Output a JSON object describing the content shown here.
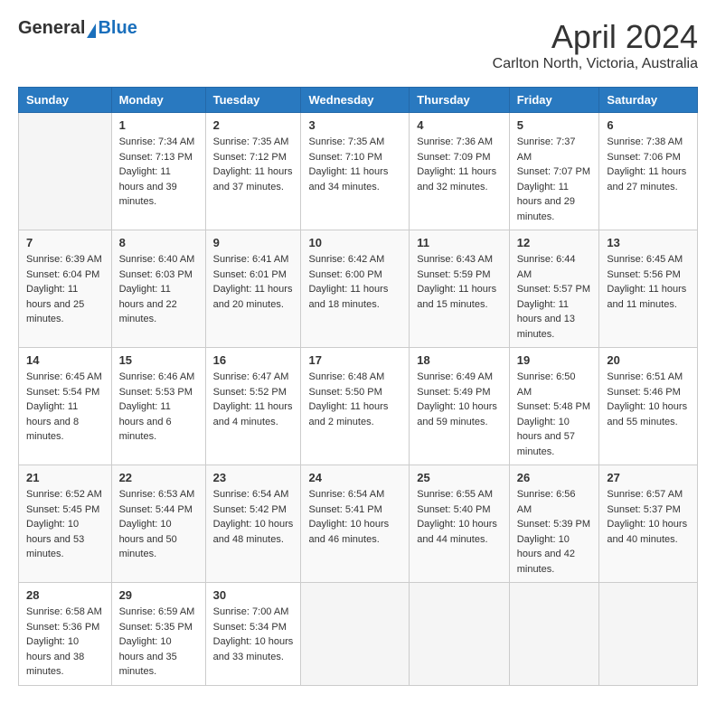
{
  "header": {
    "logo_general": "General",
    "logo_blue": "Blue",
    "month_title": "April 2024",
    "location": "Carlton North, Victoria, Australia"
  },
  "weekdays": [
    "Sunday",
    "Monday",
    "Tuesday",
    "Wednesday",
    "Thursday",
    "Friday",
    "Saturday"
  ],
  "weeks": [
    [
      {
        "day": "",
        "sunrise": "",
        "sunset": "",
        "daylight": ""
      },
      {
        "day": "1",
        "sunrise": "Sunrise: 7:34 AM",
        "sunset": "Sunset: 7:13 PM",
        "daylight": "Daylight: 11 hours and 39 minutes."
      },
      {
        "day": "2",
        "sunrise": "Sunrise: 7:35 AM",
        "sunset": "Sunset: 7:12 PM",
        "daylight": "Daylight: 11 hours and 37 minutes."
      },
      {
        "day": "3",
        "sunrise": "Sunrise: 7:35 AM",
        "sunset": "Sunset: 7:10 PM",
        "daylight": "Daylight: 11 hours and 34 minutes."
      },
      {
        "day": "4",
        "sunrise": "Sunrise: 7:36 AM",
        "sunset": "Sunset: 7:09 PM",
        "daylight": "Daylight: 11 hours and 32 minutes."
      },
      {
        "day": "5",
        "sunrise": "Sunrise: 7:37 AM",
        "sunset": "Sunset: 7:07 PM",
        "daylight": "Daylight: 11 hours and 29 minutes."
      },
      {
        "day": "6",
        "sunrise": "Sunrise: 7:38 AM",
        "sunset": "Sunset: 7:06 PM",
        "daylight": "Daylight: 11 hours and 27 minutes."
      }
    ],
    [
      {
        "day": "7",
        "sunrise": "Sunrise: 6:39 AM",
        "sunset": "Sunset: 6:04 PM",
        "daylight": "Daylight: 11 hours and 25 minutes."
      },
      {
        "day": "8",
        "sunrise": "Sunrise: 6:40 AM",
        "sunset": "Sunset: 6:03 PM",
        "daylight": "Daylight: 11 hours and 22 minutes."
      },
      {
        "day": "9",
        "sunrise": "Sunrise: 6:41 AM",
        "sunset": "Sunset: 6:01 PM",
        "daylight": "Daylight: 11 hours and 20 minutes."
      },
      {
        "day": "10",
        "sunrise": "Sunrise: 6:42 AM",
        "sunset": "Sunset: 6:00 PM",
        "daylight": "Daylight: 11 hours and 18 minutes."
      },
      {
        "day": "11",
        "sunrise": "Sunrise: 6:43 AM",
        "sunset": "Sunset: 5:59 PM",
        "daylight": "Daylight: 11 hours and 15 minutes."
      },
      {
        "day": "12",
        "sunrise": "Sunrise: 6:44 AM",
        "sunset": "Sunset: 5:57 PM",
        "daylight": "Daylight: 11 hours and 13 minutes."
      },
      {
        "day": "13",
        "sunrise": "Sunrise: 6:45 AM",
        "sunset": "Sunset: 5:56 PM",
        "daylight": "Daylight: 11 hours and 11 minutes."
      }
    ],
    [
      {
        "day": "14",
        "sunrise": "Sunrise: 6:45 AM",
        "sunset": "Sunset: 5:54 PM",
        "daylight": "Daylight: 11 hours and 8 minutes."
      },
      {
        "day": "15",
        "sunrise": "Sunrise: 6:46 AM",
        "sunset": "Sunset: 5:53 PM",
        "daylight": "Daylight: 11 hours and 6 minutes."
      },
      {
        "day": "16",
        "sunrise": "Sunrise: 6:47 AM",
        "sunset": "Sunset: 5:52 PM",
        "daylight": "Daylight: 11 hours and 4 minutes."
      },
      {
        "day": "17",
        "sunrise": "Sunrise: 6:48 AM",
        "sunset": "Sunset: 5:50 PM",
        "daylight": "Daylight: 11 hours and 2 minutes."
      },
      {
        "day": "18",
        "sunrise": "Sunrise: 6:49 AM",
        "sunset": "Sunset: 5:49 PM",
        "daylight": "Daylight: 10 hours and 59 minutes."
      },
      {
        "day": "19",
        "sunrise": "Sunrise: 6:50 AM",
        "sunset": "Sunset: 5:48 PM",
        "daylight": "Daylight: 10 hours and 57 minutes."
      },
      {
        "day": "20",
        "sunrise": "Sunrise: 6:51 AM",
        "sunset": "Sunset: 5:46 PM",
        "daylight": "Daylight: 10 hours and 55 minutes."
      }
    ],
    [
      {
        "day": "21",
        "sunrise": "Sunrise: 6:52 AM",
        "sunset": "Sunset: 5:45 PM",
        "daylight": "Daylight: 10 hours and 53 minutes."
      },
      {
        "day": "22",
        "sunrise": "Sunrise: 6:53 AM",
        "sunset": "Sunset: 5:44 PM",
        "daylight": "Daylight: 10 hours and 50 minutes."
      },
      {
        "day": "23",
        "sunrise": "Sunrise: 6:54 AM",
        "sunset": "Sunset: 5:42 PM",
        "daylight": "Daylight: 10 hours and 48 minutes."
      },
      {
        "day": "24",
        "sunrise": "Sunrise: 6:54 AM",
        "sunset": "Sunset: 5:41 PM",
        "daylight": "Daylight: 10 hours and 46 minutes."
      },
      {
        "day": "25",
        "sunrise": "Sunrise: 6:55 AM",
        "sunset": "Sunset: 5:40 PM",
        "daylight": "Daylight: 10 hours and 44 minutes."
      },
      {
        "day": "26",
        "sunrise": "Sunrise: 6:56 AM",
        "sunset": "Sunset: 5:39 PM",
        "daylight": "Daylight: 10 hours and 42 minutes."
      },
      {
        "day": "27",
        "sunrise": "Sunrise: 6:57 AM",
        "sunset": "Sunset: 5:37 PM",
        "daylight": "Daylight: 10 hours and 40 minutes."
      }
    ],
    [
      {
        "day": "28",
        "sunrise": "Sunrise: 6:58 AM",
        "sunset": "Sunset: 5:36 PM",
        "daylight": "Daylight: 10 hours and 38 minutes."
      },
      {
        "day": "29",
        "sunrise": "Sunrise: 6:59 AM",
        "sunset": "Sunset: 5:35 PM",
        "daylight": "Daylight: 10 hours and 35 minutes."
      },
      {
        "day": "30",
        "sunrise": "Sunrise: 7:00 AM",
        "sunset": "Sunset: 5:34 PM",
        "daylight": "Daylight: 10 hours and 33 minutes."
      },
      {
        "day": "",
        "sunrise": "",
        "sunset": "",
        "daylight": ""
      },
      {
        "day": "",
        "sunrise": "",
        "sunset": "",
        "daylight": ""
      },
      {
        "day": "",
        "sunrise": "",
        "sunset": "",
        "daylight": ""
      },
      {
        "day": "",
        "sunrise": "",
        "sunset": "",
        "daylight": ""
      }
    ]
  ]
}
